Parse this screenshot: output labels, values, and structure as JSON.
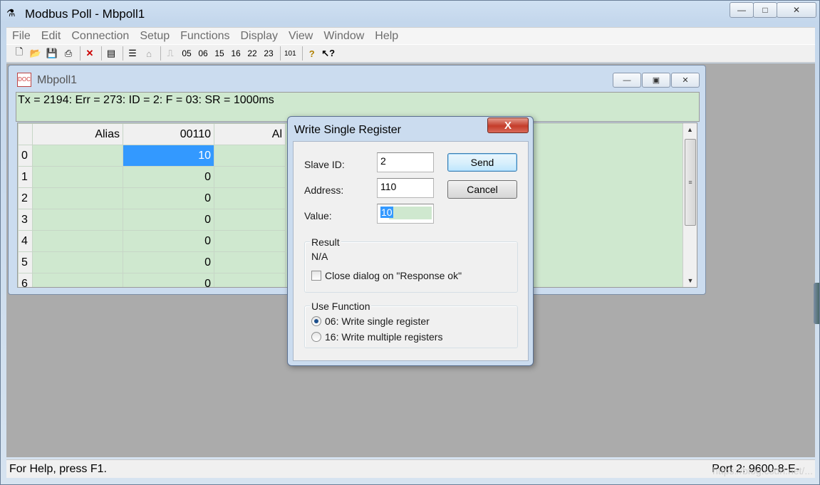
{
  "app": {
    "title": "Modbus Poll - Mbpoll1",
    "menu": [
      "File",
      "Edit",
      "Connection",
      "Setup",
      "Functions",
      "Display",
      "View",
      "Window",
      "Help"
    ],
    "toolbar_codes": [
      "05",
      "06",
      "15",
      "16",
      "22",
      "23",
      "101"
    ]
  },
  "child": {
    "title": "Mbpoll1",
    "status": "Tx = 2194: Err = 273: ID = 2: F = 03: SR = 1000ms",
    "columns": {
      "alias": "Alias",
      "address": "00110",
      "alias2": "Al"
    },
    "rows": [
      {
        "num": "0",
        "value": "10"
      },
      {
        "num": "1",
        "value": "0"
      },
      {
        "num": "2",
        "value": "0"
      },
      {
        "num": "3",
        "value": "0"
      },
      {
        "num": "4",
        "value": "0"
      },
      {
        "num": "5",
        "value": "0"
      },
      {
        "num": "6",
        "value": "0"
      }
    ]
  },
  "dialog": {
    "title": "Write Single Register",
    "close_label": "X",
    "slave_id_label": "Slave ID:",
    "slave_id_value": "2",
    "address_label": "Address:",
    "address_value": "110",
    "value_label": "Value:",
    "value_value": "10",
    "send_label": "Send",
    "cancel_label": "Cancel",
    "result_title": "Result",
    "result_value": "N/A",
    "close_on_ok_label": "Close dialog on \"Response ok\"",
    "use_function_title": "Use Function",
    "function_06_label": "06: Write single register",
    "function_16_label": "16: Write multiple registers"
  },
  "statusbar": {
    "help": "For Help, press F1.",
    "port": "Port 2: 9600-8-E-"
  },
  "watermark": "https://blog.csdn.net/..."
}
